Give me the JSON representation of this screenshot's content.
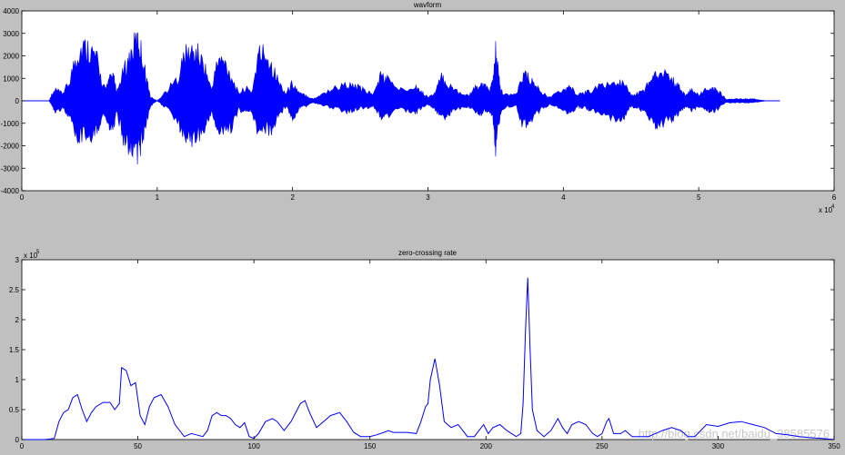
{
  "figure": {
    "background": "#c0c0c0",
    "axes_background": "#ffffff",
    "line_color": "#0000ff"
  },
  "watermark": "http://blog.csdn.net/baidu_38585576",
  "chart_data": [
    {
      "type": "line",
      "title": "wavform",
      "xlabel": "",
      "ylabel": "",
      "xlim": [
        0,
        6
      ],
      "ylim": [
        -4000,
        4000
      ],
      "x_exponent_label": "x 10",
      "x_exponent_power": "4",
      "xticks": [
        0,
        1,
        2,
        3,
        4,
        5,
        6
      ],
      "yticks": [
        -4000,
        -3000,
        -2000,
        -1000,
        0,
        1000,
        2000,
        3000,
        4000
      ],
      "grid": false,
      "envelope": {
        "x": [
          0.0,
          0.2,
          0.22,
          0.25,
          0.3,
          0.35,
          0.4,
          0.45,
          0.5,
          0.55,
          0.6,
          0.62,
          0.65,
          0.68,
          0.7,
          0.75,
          0.8,
          0.85,
          0.88,
          0.92,
          0.95,
          1.0,
          1.05,
          1.15,
          1.2,
          1.25,
          1.3,
          1.35,
          1.4,
          1.45,
          1.5,
          1.55,
          1.6,
          1.65,
          1.7,
          1.75,
          1.8,
          1.85,
          1.9,
          1.95,
          2.0,
          2.05,
          2.1,
          2.15,
          2.2,
          2.3,
          2.4,
          2.45,
          2.5,
          2.55,
          2.6,
          2.65,
          2.7,
          2.8,
          2.9,
          2.95,
          3.0,
          3.05,
          3.1,
          3.15,
          3.2,
          3.3,
          3.35,
          3.4,
          3.45,
          3.48,
          3.5,
          3.53,
          3.55,
          3.65,
          3.7,
          3.75,
          3.8,
          3.85,
          3.9,
          4.0,
          4.05,
          4.1,
          4.15,
          4.2,
          4.3,
          4.4,
          4.45,
          4.5,
          4.55,
          4.6,
          4.65,
          4.7,
          4.8,
          4.85,
          4.9,
          4.95,
          5.0,
          5.05,
          5.1,
          5.15,
          5.2,
          5.25,
          5.3,
          5.35,
          5.4,
          5.45,
          5.5,
          5.55,
          5.6
        ],
        "upper": [
          0,
          0,
          300,
          600,
          400,
          1000,
          2500,
          3000,
          2900,
          2400,
          800,
          700,
          1200,
          1300,
          400,
          1600,
          2500,
          3400,
          2800,
          1300,
          200,
          0,
          400,
          1200,
          2500,
          2700,
          2600,
          1900,
          600,
          2300,
          2100,
          1300,
          400,
          700,
          500,
          2600,
          2700,
          1900,
          1000,
          400,
          1000,
          400,
          300,
          100,
          300,
          700,
          900,
          800,
          700,
          500,
          400,
          1400,
          1200,
          600,
          900,
          500,
          200,
          400,
          1300,
          900,
          600,
          300,
          700,
          900,
          600,
          1000,
          2700,
          900,
          400,
          300,
          1500,
          1200,
          800,
          400,
          200,
          600,
          800,
          300,
          400,
          600,
          900,
          1000,
          900,
          300,
          400,
          600,
          1300,
          1700,
          1200,
          800,
          300,
          600,
          300,
          600,
          700,
          500,
          100,
          100,
          100,
          100,
          100,
          50,
          0,
          0,
          0
        ],
        "lower": [
          0,
          0,
          -200,
          -600,
          -400,
          -900,
          -2100,
          -2000,
          -1900,
          -1800,
          -700,
          -800,
          -1400,
          -1300,
          -500,
          -2200,
          -2500,
          -3000,
          -2500,
          -1200,
          -300,
          0,
          -300,
          -1100,
          -2000,
          -2100,
          -2000,
          -1600,
          -600,
          -1700,
          -1800,
          -1400,
          -500,
          -600,
          -600,
          -1900,
          -1700,
          -1600,
          -800,
          -300,
          -1000,
          -400,
          -300,
          -100,
          -200,
          -400,
          -600,
          -500,
          -400,
          -400,
          -300,
          -900,
          -800,
          -500,
          -700,
          -400,
          -200,
          -400,
          -1000,
          -800,
          -500,
          -300,
          -600,
          -700,
          -500,
          -900,
          -2500,
          -900,
          -400,
          -300,
          -1300,
          -1200,
          -700,
          -400,
          -200,
          -500,
          -700,
          -300,
          -400,
          -500,
          -800,
          -1000,
          -900,
          -300,
          -400,
          -600,
          -1200,
          -1400,
          -1000,
          -700,
          -300,
          -500,
          -300,
          -500,
          -600,
          -400,
          -100,
          -100,
          -100,
          -100,
          -100,
          -50,
          0,
          0,
          0
        ]
      }
    },
    {
      "type": "line",
      "title": "zero-crossing rate",
      "xlabel": "",
      "ylabel": "",
      "xlim": [
        0,
        350
      ],
      "ylim": [
        0,
        3
      ],
      "y_exponent_label": "x 10",
      "y_exponent_power": "5",
      "xticks": [
        0,
        50,
        100,
        150,
        200,
        250,
        300,
        350
      ],
      "yticks": [
        0,
        0.5,
        1,
        1.5,
        2,
        2.5,
        3
      ],
      "grid": false,
      "x": [
        0,
        5,
        10,
        14,
        16,
        18,
        20,
        22,
        24,
        26,
        28,
        30,
        32,
        35,
        38,
        40,
        42,
        43,
        45,
        47,
        49,
        51,
        53,
        55,
        57,
        60,
        63,
        66,
        70,
        73,
        75,
        78,
        80,
        82,
        84,
        86,
        88,
        90,
        92,
        94,
        96,
        98,
        100,
        102,
        105,
        108,
        110,
        113,
        116,
        120,
        122,
        124,
        127,
        130,
        133,
        137,
        140,
        143,
        146,
        150,
        153,
        156,
        158,
        160,
        163,
        166,
        170,
        172,
        174,
        175,
        176,
        178,
        180,
        182,
        185,
        188,
        190,
        192,
        195,
        197,
        199,
        201,
        203,
        206,
        209,
        211,
        213,
        215,
        216,
        217,
        218,
        219,
        220,
        222,
        225,
        228,
        231,
        233,
        235,
        237,
        240,
        243,
        246,
        248,
        250,
        252,
        253,
        255,
        258,
        260,
        263,
        266,
        270,
        273,
        276,
        280,
        284,
        287,
        290,
        295,
        300,
        305,
        310,
        315,
        320,
        325,
        330,
        335,
        340,
        345,
        350
      ],
      "y": [
        0,
        0,
        0,
        0.02,
        0.3,
        0.45,
        0.5,
        0.7,
        0.75,
        0.5,
        0.3,
        0.45,
        0.55,
        0.62,
        0.62,
        0.5,
        0.6,
        1.2,
        1.15,
        0.9,
        0.95,
        0.4,
        0.25,
        0.55,
        0.7,
        0.75,
        0.55,
        0.25,
        0.05,
        0.1,
        0.08,
        0.05,
        0.15,
        0.4,
        0.45,
        0.4,
        0.4,
        0.35,
        0.25,
        0.2,
        0.28,
        0.05,
        0.02,
        0.1,
        0.3,
        0.35,
        0.3,
        0.15,
        0.3,
        0.6,
        0.65,
        0.45,
        0.2,
        0.3,
        0.4,
        0.45,
        0.3,
        0.12,
        0.05,
        0.05,
        0.08,
        0.12,
        0.15,
        0.12,
        0.12,
        0.12,
        0.1,
        0.3,
        0.55,
        0.6,
        1.0,
        1.35,
        0.9,
        0.3,
        0.2,
        0.25,
        0.15,
        0.05,
        0.05,
        0.15,
        0.25,
        0.1,
        0.2,
        0.25,
        0.15,
        0.1,
        0.05,
        0.1,
        0.6,
        1.8,
        2.7,
        1.5,
        0.5,
        0.15,
        0.05,
        0.15,
        0.35,
        0.2,
        0.1,
        0.25,
        0.3,
        0.25,
        0.1,
        0.05,
        0.1,
        0.3,
        0.35,
        0.1,
        0.1,
        0.15,
        0.05,
        0.05,
        0.05,
        0.1,
        0.15,
        0.2,
        0.15,
        0.05,
        0.05,
        0.25,
        0.22,
        0.28,
        0.3,
        0.25,
        0.2,
        0.1,
        0.08,
        0.05,
        0.03,
        0.02,
        0
      ]
    }
  ]
}
